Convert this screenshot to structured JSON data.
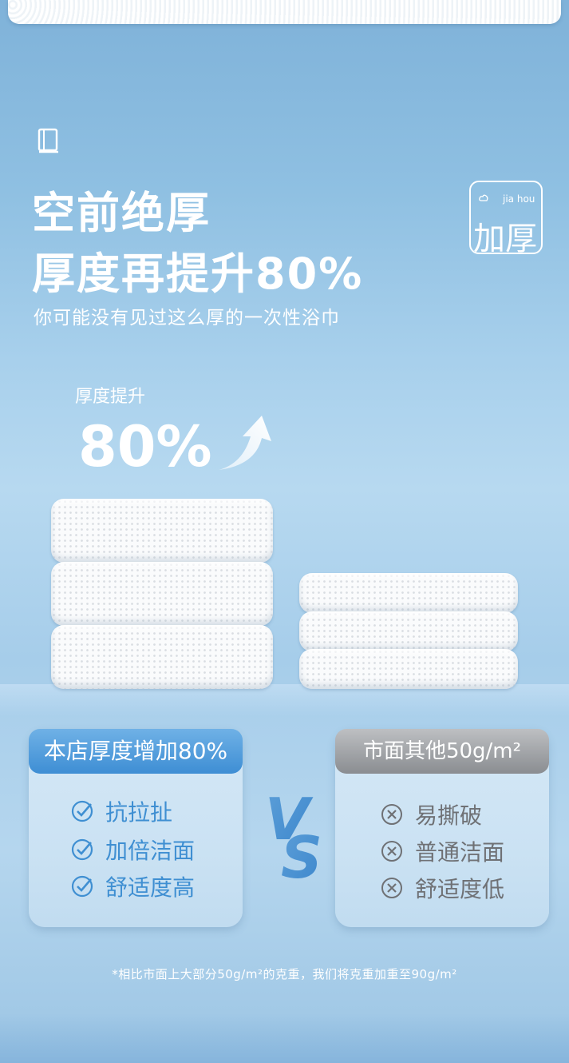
{
  "headline": {
    "line1": "空前绝厚",
    "line2": "厚度再提升80%",
    "subtitle": "你可能没有见过这么厚的一次性浴巾"
  },
  "badge": {
    "pinyin": "jia hou",
    "text": "加厚"
  },
  "increase": {
    "label": "厚度提升",
    "value": "80%"
  },
  "comparison": {
    "ours": {
      "title": "本店厚度增加80%",
      "items": [
        "抗拉扯",
        "加倍洁面",
        "舒适度高"
      ]
    },
    "vs_text": "VS",
    "others": {
      "title": "市面其他50g/m²",
      "items": [
        "易撕破",
        "普通洁面",
        "舒适度低"
      ]
    }
  },
  "footnote": "*相比市面上大部分50g/m²的克重，我们将克重加重至90g/m²",
  "icons": {
    "book": "book-icon",
    "cloud": "cloud-icon",
    "arrow": "up-arrow-icon",
    "check": "check-circle-icon",
    "cross": "cross-circle-icon"
  },
  "colors": {
    "accent_blue": "#3f8fd2",
    "grey": "#8a8d91"
  }
}
